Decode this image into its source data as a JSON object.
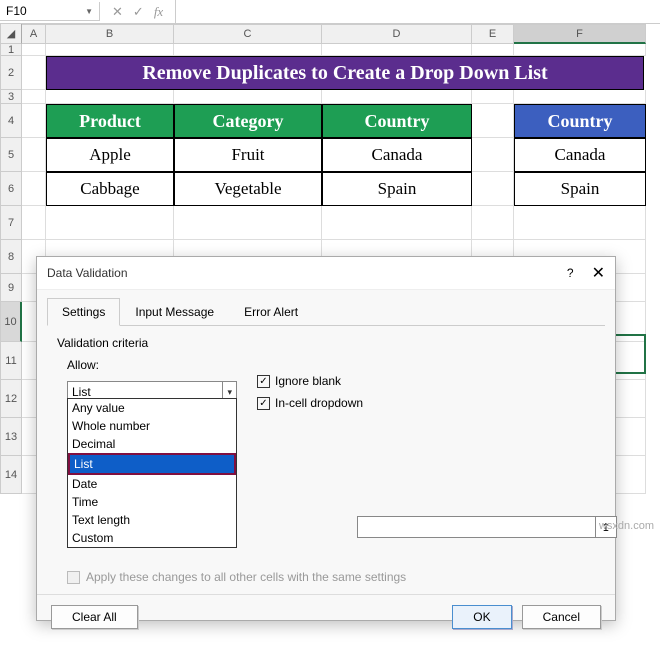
{
  "namebox": "F10",
  "fx": "fx",
  "columns": [
    "A",
    "B",
    "C",
    "D",
    "E",
    "F"
  ],
  "rows": [
    "1",
    "2",
    "3",
    "4",
    "5",
    "6",
    "7",
    "8",
    "9",
    "10",
    "11",
    "12",
    "13",
    "14"
  ],
  "title": "Remove Duplicates to Create a Drop Down List",
  "table": {
    "headers": [
      "Product",
      "Category",
      "Country"
    ],
    "rows": [
      [
        "Apple",
        "Fruit",
        "Canada"
      ],
      [
        "Cabbage",
        "Vegetable",
        "Spain"
      ]
    ],
    "side_header": "Country",
    "side_rows": [
      "Canada",
      "Spain"
    ]
  },
  "dialog": {
    "title": "Data Validation",
    "help": "?",
    "close": "✕",
    "tabs": [
      "Settings",
      "Input Message",
      "Error Alert"
    ],
    "criteria": "Validation criteria",
    "allow_label": "Allow:",
    "allow_value": "List",
    "ignore_blank": "Ignore blank",
    "incell": "In-cell dropdown",
    "options": [
      "Any value",
      "Whole number",
      "Decimal",
      "List",
      "Date",
      "Time",
      "Text length",
      "Custom"
    ],
    "source_pick": "↥",
    "apply": "Apply these changes to all other cells with the same settings",
    "clear": "Clear All",
    "ok": "OK",
    "cancel": "Cancel"
  },
  "watermark": "wsxdn.com"
}
